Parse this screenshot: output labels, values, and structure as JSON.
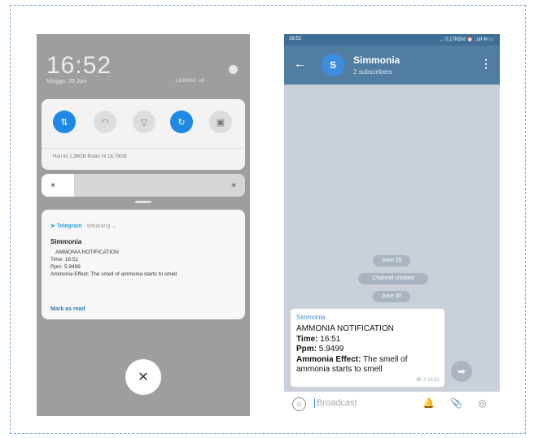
{
  "left_screen": {
    "clock": "16:52",
    "date": "Minggu, 30 Juni",
    "status": "1,83KB/d  ..ull ·.",
    "quick_settings": {
      "buttons": [
        {
          "icon": "data-transfer-icon",
          "glyph": "⇅",
          "active": true
        },
        {
          "icon": "wifi-icon",
          "glyph": "◠",
          "active": false
        },
        {
          "icon": "flashlight-icon",
          "glyph": "▽",
          "active": false
        },
        {
          "icon": "rotation-icon",
          "glyph": "↻",
          "active": true
        },
        {
          "icon": "screenshot-icon",
          "glyph": "▣",
          "active": false
        }
      ],
      "info_line": "Hari ini 1,36GB   Bulan ini 18,79GB"
    },
    "brightness_low_icon": "☀",
    "brightness_high_icon": "☀",
    "notification": {
      "app": "Telegram",
      "app_sub": "· sekarang ⌄",
      "title": "Simmonia",
      "lines": [
        "AMMONIA NOTIFICATION",
        "Time: 16:51",
        "Ppm: 5.9499",
        "Ammonia Effect: The smell of ammonia starts to smell"
      ],
      "action": "Mark as read"
    },
    "close_symbol": "✕"
  },
  "right_screen": {
    "status_time": "16:52",
    "status_right": "... 0,17KB/d ⏰ ..ull ✉ ▭",
    "back_icon": "←",
    "avatar_letter": "S",
    "channel_name": "Simmonia",
    "subscribers": "2 subscribers",
    "menu_icon": "⋮",
    "pills": [
      "June 29",
      "Channel created",
      "June 30"
    ],
    "message": {
      "sender": "Simmonia",
      "line1": "AMMONIA NOTIFICATION",
      "time_label": "Time:",
      "time_value": " 16:51",
      "ppm_label": "Ppm:",
      "ppm_value": " 5.9499",
      "effect_label": "Ammonia Effect:",
      "effect_value": " The smell of",
      "effect_cont": "ammonia starts to smell",
      "meta": "👁 2  16:51"
    },
    "share_icon": "➦",
    "input_placeholder": "Broadcast",
    "bottom_icons": {
      "emoji": "☺",
      "bell": "🔔",
      "attach": "📎",
      "camera": "◎"
    }
  }
}
